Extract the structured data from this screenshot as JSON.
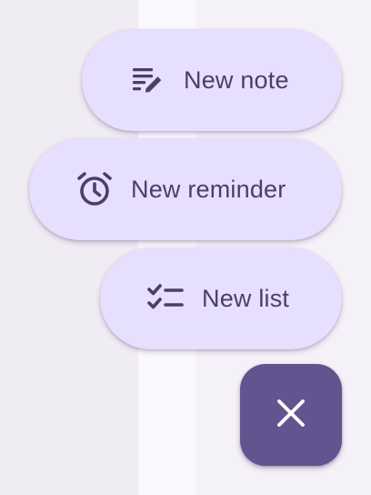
{
  "speed_dial": {
    "items": [
      {
        "label": "New note",
        "icon": "note-pen-icon"
      },
      {
        "label": "New reminder",
        "icon": "alarm-clock-icon"
      },
      {
        "label": "New list",
        "icon": "checklist-icon"
      }
    ],
    "close_icon": "close-icon"
  },
  "colors": {
    "chip_background": "#e7dffe",
    "chip_text": "#4a3f6b",
    "fab_background": "#63548f",
    "fab_icon": "#ffffff"
  }
}
